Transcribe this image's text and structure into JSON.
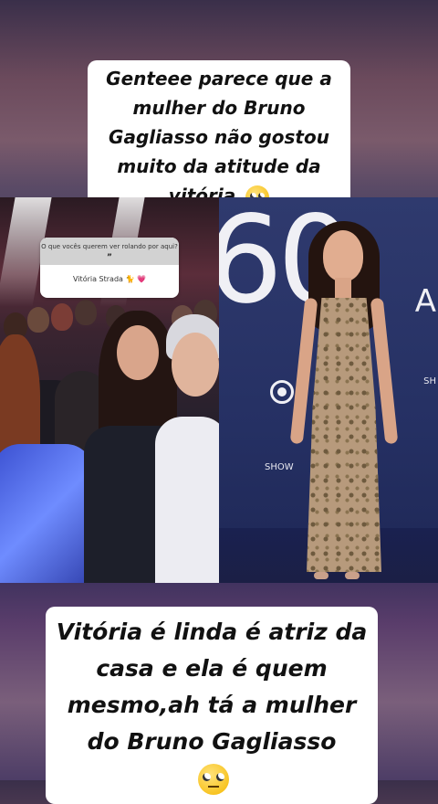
{
  "top_caption": {
    "text": "Genteee parece que a mulher do Bruno Gagliasso não gostou muito da atitude da vitória",
    "emoji": "face-with-rolling-eyes"
  },
  "left_photo": {
    "question_sticker": {
      "question": "O que vocês querem ver rolando por aqui?",
      "quote_mark": "”",
      "answer": "Vitória Strada",
      "answer_emojis": "🐈 💗"
    }
  },
  "right_photo": {
    "backdrop_number": "60",
    "backdrop_letter": "A",
    "backdrop_text_left": "SHOW",
    "backdrop_text_right": "SH"
  },
  "bottom_caption": {
    "text": "Vitória é linda é atriz da casa e ela é quem mesmo,ah tá a mulher do Bruno Gagliasso",
    "emoji": "face-with-rolling-eyes"
  },
  "colors": {
    "caption_bg": "#ffffff",
    "caption_text": "#111111",
    "backdrop_blue": "#2a3568"
  }
}
